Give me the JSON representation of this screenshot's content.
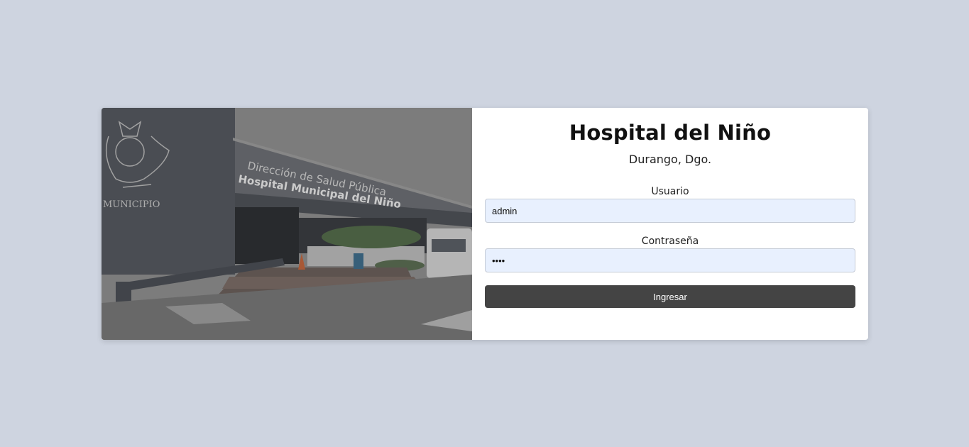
{
  "login": {
    "title": "Hospital del Niño",
    "subtitle": "Durango, Dgo.",
    "username_label": "Usuario",
    "username_value": "admin",
    "password_label": "Contraseña",
    "password_value": "••••",
    "submit_label": "Ingresar"
  },
  "photo": {
    "sign_line1": "Dirección de Salud Pública",
    "sign_line2": "Hospital Municipal del Niño",
    "emblem_text": "MUNICIPIO"
  },
  "colors": {
    "background": "#ced4e0",
    "card": "#ffffff",
    "input_fill": "#e8f0fe",
    "button": "#444444"
  }
}
